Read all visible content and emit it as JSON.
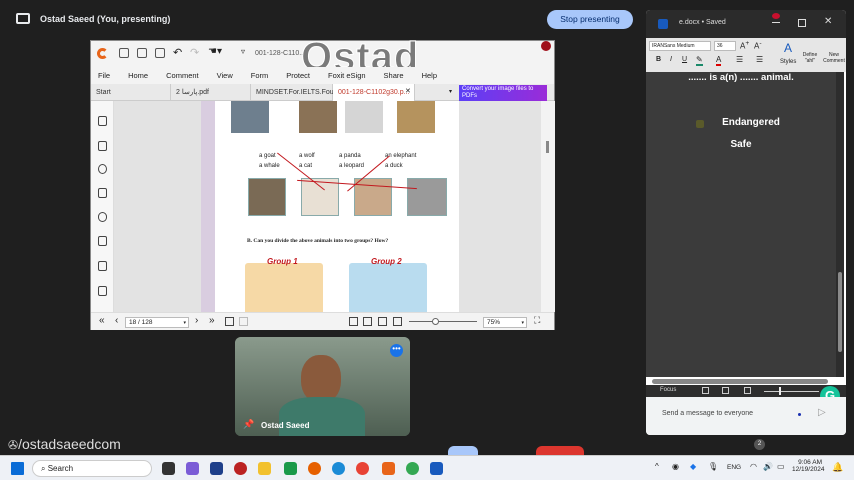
{
  "meet": {
    "presenter_title": "Ostad Saeed (You, presenting)",
    "stop_presenting": "Stop presenting",
    "participant_name": "Ostad Saeed",
    "participant_count": "2",
    "chat_placeholder": "Send a message to everyone",
    "watermark_handle": "/ostadsaeedcom"
  },
  "foxit": {
    "doc_title": "001-128-C110...",
    "overlay_watermark": "Ostad Saeed",
    "menu": [
      "File",
      "Home",
      "Comment",
      "View",
      "Form",
      "Protect",
      "Foxit eSign",
      "Share",
      "Help"
    ],
    "tabs": [
      "Start",
      "2 پارسا.pdf",
      "MINDSET.For.IELTS.Fou...",
      "001-128-C1102g30.p..."
    ],
    "active_tab": 3,
    "convert_banner": "Convert your image files to PDFs",
    "page_indicator": "18 / 128",
    "zoom": "75%",
    "page": {
      "animal_labels_row": [
        [
          "a goat",
          "a whale"
        ],
        [
          "a wolf",
          "a cat"
        ],
        [
          "a panda",
          "a leopard"
        ],
        [
          "an elephant",
          "a duck"
        ]
      ],
      "question": "B. Can you divide the above animals into two groups? How?",
      "group1": "Group 1",
      "group2": "Group 2"
    }
  },
  "word": {
    "title": "e.docx • Saved",
    "font_name": "IRANSans Medium",
    "font_size": "36",
    "ribbon_styles": "Styles",
    "ribbon_define": "Define \"ahl\"",
    "ribbon_new_comment": "New Comment",
    "doc_lines": [
      "....... is a(n) ....... animal.",
      "Endangered",
      "Safe"
    ],
    "focus_label": "Focus"
  },
  "taskbar": {
    "search": "Search",
    "language": "ENG",
    "time": "9:06 AM",
    "date": "12/19/2024"
  },
  "colors": {
    "stop_button": "#a8c7fa",
    "foxit_orange": "#e8651a",
    "annotation_red": "#c2181e",
    "word_blue": "#185abd"
  }
}
